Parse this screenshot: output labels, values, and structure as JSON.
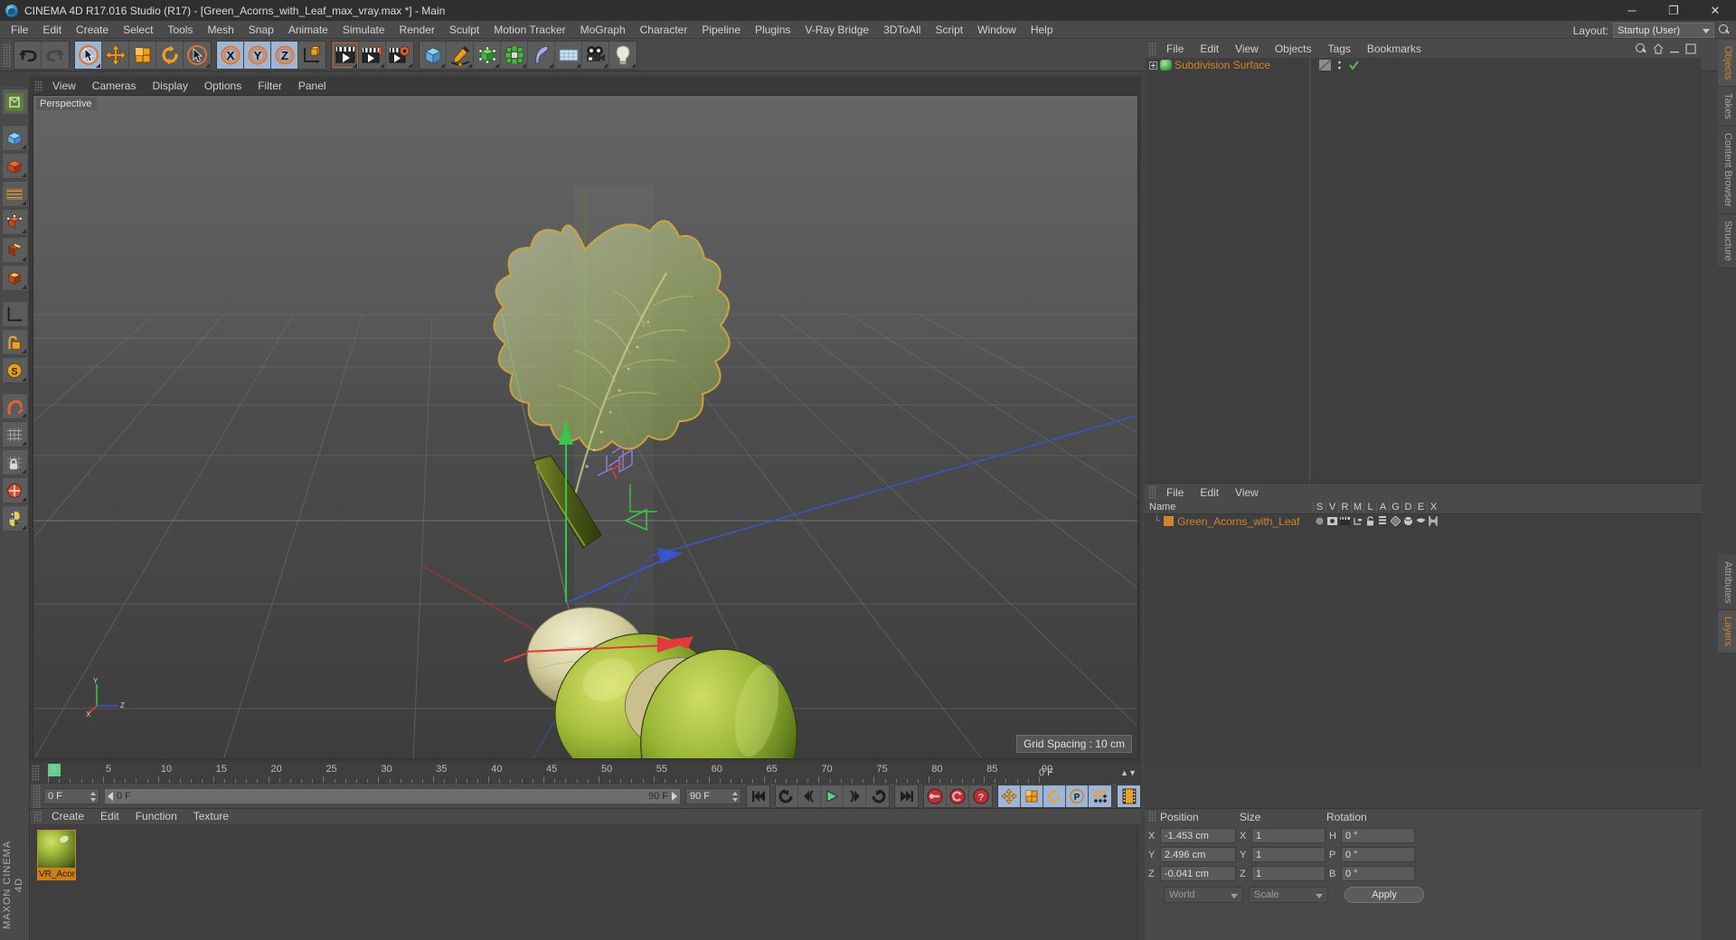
{
  "window": {
    "title": "CINEMA 4D R17.016 Studio (R17) - [Green_Acorns_with_Leaf_max_vray.max *] - Main",
    "minimize": "─",
    "maximize": "❐",
    "close": "✕"
  },
  "menubar": {
    "items": [
      "File",
      "Edit",
      "Create",
      "Select",
      "Tools",
      "Mesh",
      "Snap",
      "Animate",
      "Simulate",
      "Render",
      "Sculpt",
      "Motion Tracker",
      "MoGraph",
      "Character",
      "Pipeline",
      "Plugins",
      "V-Ray Bridge",
      "3DToAll",
      "Script",
      "Window",
      "Help"
    ]
  },
  "layout": {
    "label": "Layout:",
    "value": "Startup (User)",
    "search_icon": "search-icon"
  },
  "toolbar": {
    "groups": [
      {
        "name": "history",
        "buttons": [
          {
            "name": "undo-button",
            "icon": "undo-arrow-icon"
          },
          {
            "name": "redo-button",
            "icon": "redo-arrow-icon"
          }
        ]
      },
      {
        "name": "tools",
        "buttons": [
          {
            "name": "select-tool",
            "icon": "live-selection-icon",
            "selected": true
          },
          {
            "name": "move-tool",
            "icon": "move-icon"
          },
          {
            "name": "scale-tool",
            "icon": "scale-icon"
          },
          {
            "name": "rotate-tool",
            "icon": "rotate-icon"
          },
          {
            "name": "last-used-tool",
            "icon": "cursor-ring-icon"
          }
        ]
      },
      {
        "name": "axis-locks",
        "buttons": [
          {
            "name": "lock-x-axis",
            "icon": "x-axis-icon",
            "selected": true
          },
          {
            "name": "lock-y-axis",
            "icon": "y-axis-icon",
            "selected": true
          },
          {
            "name": "lock-z-axis",
            "icon": "z-axis-icon",
            "selected": true
          },
          {
            "name": "world-object-coord",
            "icon": "world-coord-icon"
          }
        ]
      },
      {
        "name": "render",
        "buttons": [
          {
            "name": "render-view-button",
            "icon": "render-view-icon"
          },
          {
            "name": "render-to-picture-viewer-button",
            "icon": "render-picture-icon"
          },
          {
            "name": "render-settings-button",
            "icon": "render-settings-icon"
          }
        ]
      },
      {
        "name": "creation",
        "buttons": [
          {
            "name": "add-cube-button",
            "icon": "cube-icon"
          },
          {
            "name": "add-spline-button",
            "icon": "pen-spline-icon"
          },
          {
            "name": "add-generator-button",
            "icon": "subdivision-generator-icon"
          },
          {
            "name": "add-mograph-button",
            "icon": "mograph-cloner-icon"
          },
          {
            "name": "add-deformer-button",
            "icon": "bend-deformer-icon"
          },
          {
            "name": "add-floor-button",
            "icon": "floor-environment-icon"
          },
          {
            "name": "add-camera-button",
            "icon": "camera-icon"
          },
          {
            "name": "add-light-button",
            "icon": "light-bulb-icon"
          }
        ]
      }
    ]
  },
  "left_palette": {
    "buttons": [
      {
        "name": "cinema-logo-button",
        "icon": "c4d-logo-icon"
      },
      {
        "name": "make-editable-button",
        "icon": "make-editable-icon"
      },
      {
        "name": "model-mode-button",
        "icon": "model-mode-icon"
      },
      {
        "name": "texture-mode-button",
        "icon": "texture-mode-icon"
      },
      {
        "name": "points-mode-button",
        "icon": "points-mode-icon"
      },
      {
        "name": "edges-mode-button",
        "icon": "edges-mode-icon"
      },
      {
        "name": "polygons-mode-button",
        "icon": "polygons-mode-icon"
      },
      {
        "name": "axis-modify-button",
        "icon": "axis-modify-icon"
      },
      {
        "name": "enable-axis-button",
        "icon": "enable-axis-icon"
      },
      {
        "name": "viewport-solo-button",
        "icon": "viewport-solo-icon"
      },
      {
        "name": "magnet-button",
        "icon": "magnet-icon"
      },
      {
        "name": "workplane-button",
        "icon": "workplane-icon"
      },
      {
        "name": "lock-workplane-button",
        "icon": "lock-workplane-icon"
      },
      {
        "name": "snap-button",
        "icon": "snap-icon"
      },
      {
        "name": "python-button",
        "icon": "python-icon"
      }
    ],
    "brand": "MAXON CINEMA 4D"
  },
  "viewport": {
    "menu": [
      "View",
      "Cameras",
      "Display",
      "Options",
      "Filter",
      "Panel"
    ],
    "label": "Perspective",
    "grid_spacing": "Grid Spacing : 10 cm",
    "axis_gizmo": {
      "x": "X",
      "y": "Y",
      "z": "Z"
    },
    "scene_object": "Green acorns with oak leaf"
  },
  "timeline": {
    "ticks": [
      {
        "label": "0",
        "value": 0
      },
      {
        "label": "5",
        "value": 5
      },
      {
        "label": "10",
        "value": 10
      },
      {
        "label": "15",
        "value": 15
      },
      {
        "label": "20",
        "value": 20
      },
      {
        "label": "25",
        "value": 25
      },
      {
        "label": "30",
        "value": 30
      },
      {
        "label": "35",
        "value": 35
      },
      {
        "label": "40",
        "value": 40
      },
      {
        "label": "45",
        "value": 45
      },
      {
        "label": "50",
        "value": 50
      },
      {
        "label": "55",
        "value": 55
      },
      {
        "label": "60",
        "value": 60
      },
      {
        "label": "65",
        "value": 65
      },
      {
        "label": "70",
        "value": 70
      },
      {
        "label": "75",
        "value": 75
      },
      {
        "label": "80",
        "value": 80
      },
      {
        "label": "85",
        "value": 85
      },
      {
        "label": "90",
        "value": 90
      }
    ],
    "range_min": 0,
    "range_max": 90,
    "playhead": 0,
    "end_display": "0 F"
  },
  "transport": {
    "current_frame": "0 F",
    "scroll_start": "0 F",
    "scroll_end": "90 F",
    "end_frame": "90 F",
    "buttons": [
      {
        "name": "go-to-start-button",
        "icon": "skip-start-icon"
      },
      {
        "name": "play-backwards-button",
        "icon": "play-backwards-icon"
      },
      {
        "name": "previous-frame-button",
        "icon": "prev-frame-icon"
      },
      {
        "name": "play-button",
        "icon": "play-icon"
      },
      {
        "name": "next-frame-button",
        "icon": "next-frame-icon"
      },
      {
        "name": "play-forwards-button",
        "icon": "play-forwards-icon"
      },
      {
        "name": "go-to-end-button",
        "icon": "skip-end-icon"
      }
    ],
    "key_buttons": [
      {
        "name": "record-active-objects-button",
        "icon": "record-key-icon"
      },
      {
        "name": "autokeying-button",
        "icon": "autokey-icon"
      },
      {
        "name": "keyframe-selection-button",
        "icon": "keyframe-selection-icon"
      }
    ],
    "track_buttons": [
      {
        "name": "position-key-toggle",
        "icon": "position-icon",
        "selected": true
      },
      {
        "name": "scale-key-toggle",
        "icon": "scale-icon",
        "selected": true
      },
      {
        "name": "rotation-key-toggle",
        "icon": "rotation-icon",
        "selected": true
      },
      {
        "name": "parameter-key-toggle",
        "icon": "parameter-p-icon",
        "selected": true
      },
      {
        "name": "point-level-animation-toggle",
        "icon": "pla-dots-icon",
        "selected": true
      }
    ],
    "extra_button": {
      "name": "timeline-filmstrip-button",
      "icon": "filmstrip-icon"
    }
  },
  "material_manager": {
    "menu": [
      "Create",
      "Edit",
      "Function",
      "Texture"
    ],
    "materials": [
      {
        "name": "VR_Acor",
        "full_name": "VR_Acorn",
        "swatch_icon": "material-sphere-icon"
      }
    ]
  },
  "object_manager": {
    "menu": [
      "File",
      "Edit",
      "View",
      "Objects",
      "Tags",
      "Bookmarks"
    ],
    "header_icons": [
      "search-icon",
      "home-icon",
      "minimize-icon",
      "maximize-icon"
    ],
    "objects": [
      {
        "name": "Subdivision Surface",
        "icon": "subdivision-surface-icon",
        "expandable": true,
        "tags": [
          "visibility-dots-icon",
          "checkmark-icon"
        ]
      }
    ]
  },
  "scene_manager": {
    "menu": [
      "File",
      "Edit",
      "View"
    ],
    "columns": [
      "Name",
      "S",
      "V",
      "R",
      "M",
      "L",
      "A",
      "G",
      "D",
      "E",
      "X"
    ],
    "rows": [
      {
        "name": "Green_Acorns_with_Leaf",
        "cells": [
          "dot-icon",
          "visibility-icon",
          "render-icon",
          "hierarchy-icon",
          "lock-open-icon",
          "list-icon",
          "axis-icon",
          "sphere-icon",
          "bowl-icon",
          "deform-icon"
        ]
      }
    ]
  },
  "coordinates": {
    "headers": {
      "position": "Position",
      "size": "Size",
      "rotation": "Rotation"
    },
    "rows": [
      {
        "pos_axis": "X",
        "pos_value": "-1.453 cm",
        "size_axis": "X",
        "size_value": "1",
        "rot_axis": "H",
        "rot_value": "0 °"
      },
      {
        "pos_axis": "Y",
        "pos_value": "2.496 cm",
        "size_axis": "Y",
        "size_value": "1",
        "rot_axis": "P",
        "rot_value": "0 °"
      },
      {
        "pos_axis": "Z",
        "pos_value": "-0.041 cm",
        "size_axis": "Z",
        "size_value": "1",
        "rot_axis": "B",
        "rot_value": "0 °"
      }
    ],
    "coord_system": "World",
    "transform_mode": "Scale",
    "apply_label": "Apply"
  },
  "vertical_tabs": {
    "top": [
      {
        "label": "Objects",
        "active": true
      },
      {
        "label": "Takes",
        "active": false
      },
      {
        "label": "Content Browser",
        "active": false
      },
      {
        "label": "Structure",
        "active": false
      }
    ],
    "bottom": [
      {
        "label": "Attributes",
        "active": false
      },
      {
        "label": "Layers",
        "active": true
      }
    ]
  },
  "colors": {
    "accent_orange": "#d2822a",
    "selected_blue": "#9fb5d6",
    "play_green": "#5fcf8e",
    "key_red": "#c0392b",
    "panel_bg": "#4a4a4a",
    "field_bg": "#5a5a5a"
  }
}
